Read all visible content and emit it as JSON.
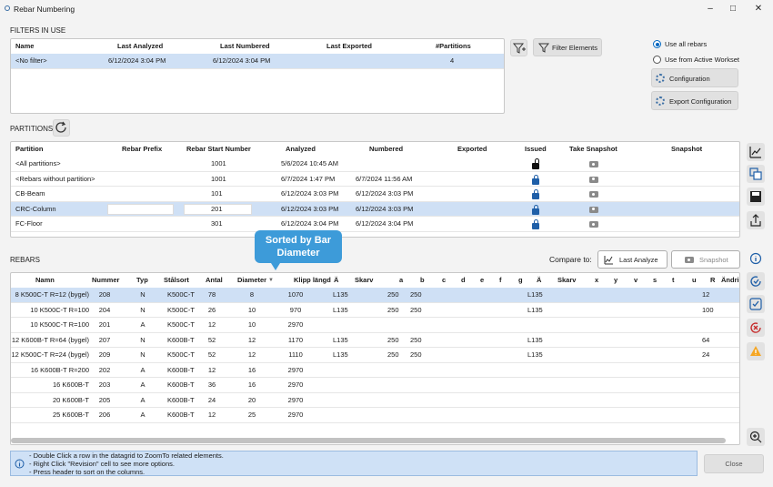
{
  "window": {
    "title": "Rebar Numbering",
    "controls": [
      "minimize",
      "maximize",
      "close"
    ]
  },
  "filters": {
    "section_label": "FILTERS IN USE",
    "columns": [
      "Name",
      "Last Analyzed",
      "Last Numbered",
      "Last Exported",
      "#Partitions"
    ],
    "rows": [
      {
        "name": "<No filter>",
        "last_analyzed": "6/12/2024 3:04 PM",
        "last_numbered": "6/12/2024 3:04 PM",
        "last_exported": "",
        "partitions": "4"
      }
    ],
    "filter_elements_label": "Filter Elements"
  },
  "options": {
    "use_all_rebars": "Use all rebars",
    "use_from_active_workset": "Use from Active Workset",
    "selected": "use_all_rebars",
    "configuration_label": "Configuration",
    "export_configuration_label": "Export Configuration"
  },
  "partitions": {
    "section_label": "PARTITIONS",
    "columns": [
      "Partition",
      "Rebar Prefix",
      "Rebar Start Number",
      "Analyzed",
      "Numbered",
      "Exported",
      "Issued",
      "Take Snapshot",
      "Snapshot"
    ],
    "rows": [
      {
        "partition": "<All partitions>",
        "prefix": "",
        "start": "1001",
        "analyzed": "5/6/2024 10:45 AM",
        "numbered": "",
        "exported": "",
        "issued": "unlocked"
      },
      {
        "partition": "<Rebars without partition>",
        "prefix": "",
        "start": "1001",
        "analyzed": "6/7/2024 1:47 PM",
        "numbered": "6/7/2024 11:56 AM",
        "exported": "",
        "issued": "locked"
      },
      {
        "partition": "CB-Beam",
        "prefix": "",
        "start": "101",
        "analyzed": "6/12/2024 3:03 PM",
        "numbered": "6/12/2024 3:03 PM",
        "exported": "",
        "issued": "locked"
      },
      {
        "partition": "CRC-Column",
        "prefix": "",
        "start": "201",
        "analyzed": "6/12/2024 3:03 PM",
        "numbered": "6/12/2024 3:03 PM",
        "exported": "",
        "issued": "locked"
      },
      {
        "partition": "FC-Floor",
        "prefix": "",
        "start": "301",
        "analyzed": "6/12/2024 3:04 PM",
        "numbered": "6/12/2024 3:04 PM",
        "exported": "",
        "issued": "locked"
      }
    ],
    "selected_index": 3
  },
  "rebars": {
    "section_label": "REBARS",
    "compare_to_label": "Compare to:",
    "last_analyze_label": "Last Analyze",
    "snapshot_label": "Snapshot",
    "callout": "Sorted by Bar Diameter",
    "sort_indicator": "▼",
    "columns": [
      "Namn",
      "Nummer",
      "Typ",
      "Stålsort",
      "Antal",
      "Diameter",
      "Klipp längd",
      "Ä",
      "Skarv",
      "a",
      "b",
      "c",
      "d",
      "e",
      "f",
      "g",
      "Ä",
      "Skarv",
      "x",
      "y",
      "v",
      "s",
      "t",
      "u",
      "R",
      "Ändrin"
    ],
    "rows": [
      {
        "namn": "8 K500C-T R=12 (bygel)",
        "nummer": "208",
        "typ": "N",
        "stalsort": "K500C-T",
        "antal": "78",
        "diameter": "8",
        "klipp": "1070",
        "a1": "L135",
        "a": "250",
        "b": "250",
        "a2": "L135",
        "r": "12"
      },
      {
        "namn": "10 K500C-T R=100",
        "nummer": "204",
        "typ": "N",
        "stalsort": "K500C-T",
        "antal": "26",
        "diameter": "10",
        "klipp": "970",
        "a1": "L135",
        "a": "250",
        "b": "250",
        "a2": "L135",
        "r": "100"
      },
      {
        "namn": "10 K500C-T R=100",
        "nummer": "201",
        "typ": "A",
        "stalsort": "K500C-T",
        "antal": "12",
        "diameter": "10",
        "klipp": "2970",
        "a1": "",
        "a": "",
        "b": "",
        "a2": "",
        "r": ""
      },
      {
        "namn": "12 K600B-T R=64 (bygel)",
        "nummer": "207",
        "typ": "N",
        "stalsort": "K600B-T",
        "antal": "52",
        "diameter": "12",
        "klipp": "1170",
        "a1": "L135",
        "a": "250",
        "b": "250",
        "a2": "L135",
        "r": "64"
      },
      {
        "namn": "12 K500C-T R=24 (bygel)",
        "nummer": "209",
        "typ": "N",
        "stalsort": "K500C-T",
        "antal": "52",
        "diameter": "12",
        "klipp": "1110",
        "a1": "L135",
        "a": "250",
        "b": "250",
        "a2": "L135",
        "r": "24"
      },
      {
        "namn": "16 K600B-T R=200",
        "nummer": "202",
        "typ": "A",
        "stalsort": "K600B-T",
        "antal": "12",
        "diameter": "16",
        "klipp": "2970",
        "a1": "",
        "a": "",
        "b": "",
        "a2": "",
        "r": ""
      },
      {
        "namn": "16 K600B-T",
        "nummer": "203",
        "typ": "A",
        "stalsort": "K600B-T",
        "antal": "36",
        "diameter": "16",
        "klipp": "2970",
        "a1": "",
        "a": "",
        "b": "",
        "a2": "",
        "r": ""
      },
      {
        "namn": "20 K600B-T",
        "nummer": "205",
        "typ": "A",
        "stalsort": "K600B-T",
        "antal": "24",
        "diameter": "20",
        "klipp": "2970",
        "a1": "",
        "a": "",
        "b": "",
        "a2": "",
        "r": ""
      },
      {
        "namn": "25 K600B-T",
        "nummer": "206",
        "typ": "A",
        "stalsort": "K600B-T",
        "antal": "12",
        "diameter": "25",
        "klipp": "2970",
        "a1": "",
        "a": "",
        "b": "",
        "a2": "",
        "r": ""
      }
    ],
    "selected_index": 0
  },
  "info": {
    "lines": [
      "- Double Click a row in the datagrid to ZoomTo related elements.",
      "- Right Click \"Revision\" cell to see more options.",
      "- Press header to sort on the columns."
    ],
    "close_label": "Close"
  },
  "side_toolbar": [
    "chart-icon",
    "copy-icon",
    "save-icon",
    "export-icon",
    "info-icon",
    "refresh-check-icon",
    "check-icon",
    "reset-icon",
    "warning-icon",
    "zoom-in-icon"
  ],
  "colors": {
    "selection": "#cfe0f5",
    "accent": "#0067c0",
    "callout": "#3d9bd9",
    "info_bar": "#cfe1f6"
  }
}
